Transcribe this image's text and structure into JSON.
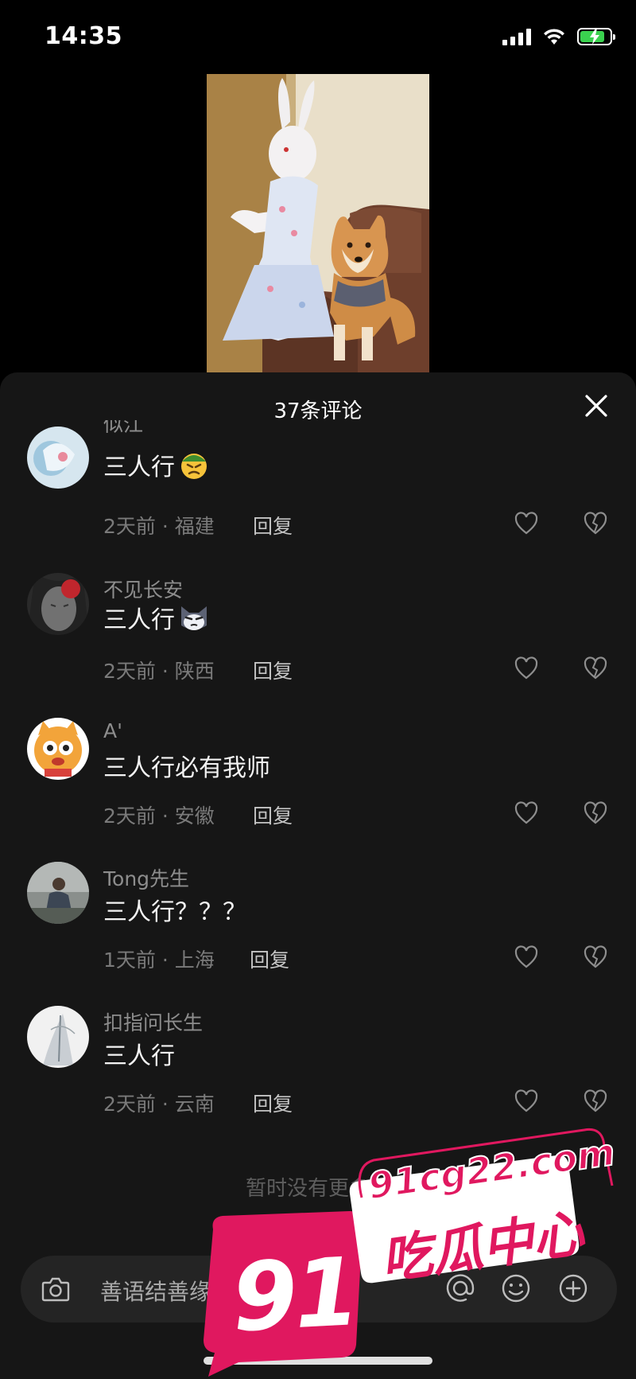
{
  "status": {
    "time": "14:35"
  },
  "sheet": {
    "title": "37条评论"
  },
  "comments": [
    {
      "username": "似江",
      "text": "三人行",
      "time": "2天前",
      "location": "福建",
      "reply": "回复"
    },
    {
      "username": "不见长安",
      "text": "三人行",
      "time": "2天前",
      "location": "陕西",
      "reply": "回复"
    },
    {
      "username": "A'",
      "text": "三人行必有我师",
      "time": "2天前",
      "location": "安徽",
      "reply": "回复"
    },
    {
      "username": "Tong先生",
      "text": "三人行？？？",
      "time": "1天前",
      "location": "上海",
      "reply": "回复"
    },
    {
      "username": "扣指问长生",
      "text": "三人行",
      "time": "2天前",
      "location": "云南",
      "reply": "回复"
    }
  ],
  "footer": {
    "no_more": "暂时没有更多了"
  },
  "input": {
    "placeholder": "善语结善缘，恶言伤人心"
  },
  "watermark": {
    "number": "91",
    "url": "91cg22.com",
    "name": "吃瓜中心"
  },
  "colors": {
    "sheet_bg": "#161616",
    "accent_pink": "#e0185f",
    "battery_green": "#3ad24f"
  }
}
